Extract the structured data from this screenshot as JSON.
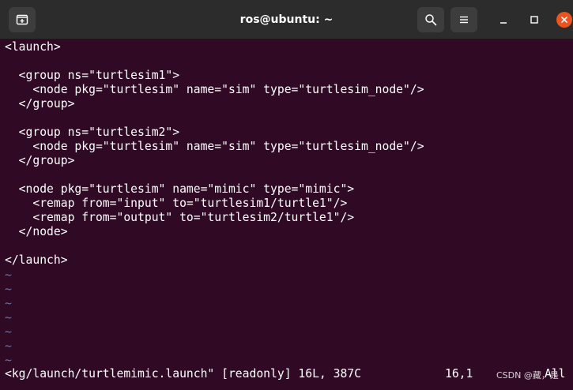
{
  "window": {
    "title": "ros@ubuntu: ~"
  },
  "titlebar": {
    "icons": {
      "new_tab": "new-tab-icon",
      "search": "search-icon",
      "menu": "hamburger-menu-icon",
      "minimize": "minimize-icon",
      "maximize": "maximize-icon",
      "close": "close-icon"
    },
    "colors": {
      "bar": "#2c2c2c",
      "button": "#3d3d3d",
      "close": "#e95420"
    }
  },
  "terminal": {
    "background": "#300a24",
    "lines": [
      "<launch>",
      "",
      "  <group ns=\"turtlesim1\">",
      "    <node pkg=\"turtlesim\" name=\"sim\" type=\"turtlesim_node\"/>",
      "  </group>",
      "",
      "  <group ns=\"turtlesim2\">",
      "    <node pkg=\"turtlesim\" name=\"sim\" type=\"turtlesim_node\"/>",
      "  </group>",
      "",
      "  <node pkg=\"turtlesim\" name=\"mimic\" type=\"mimic\">",
      "    <remap from=\"input\" to=\"turtlesim1/turtle1\"/>",
      "    <remap from=\"output\" to=\"turtlesim2/turtle1\"/>",
      "  </node>",
      "",
      "</launch>"
    ],
    "empty_marker": "~",
    "empty_line_count": 7
  },
  "status_line": {
    "file": "<kg/launch/turtlemimic.launch\" [readonly] 16L, 387C",
    "position": "16,1",
    "scroll": "All"
  },
  "watermark": "CSDN @藏，是"
}
